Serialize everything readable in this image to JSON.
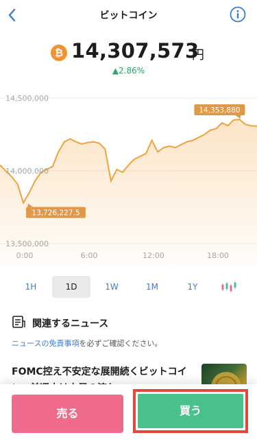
{
  "header": {
    "title": "ビットコイン",
    "back_icon": "chevron-left-icon",
    "info_icon": "info-icon"
  },
  "price": {
    "coin_symbol": "₿",
    "value": "14,307,573",
    "unit": "円",
    "change": "▲2.86%",
    "change_color": "#2ea36f"
  },
  "chart_data": {
    "type": "area",
    "color": "#f0a23b",
    "y_ticks": [
      "14,500,000",
      "14,000,000",
      "13,500,000"
    ],
    "x_ticks": [
      "0:00",
      "6:00",
      "12:00",
      "18:00"
    ],
    "ylim": [
      13500000,
      14500000
    ],
    "max_label": "14,353,880",
    "min_label": "13,726,227.5",
    "y": [
      14040000,
      14000000,
      13960000,
      13910000,
      13780000,
      13850000,
      13930000,
      13990000,
      14010000,
      14030000,
      14130000,
      14200000,
      14220000,
      14200000,
      14185000,
      14195000,
      14200000,
      14190000,
      14150000,
      13930000,
      14010000,
      13990000,
      14040000,
      14080000,
      14100000,
      14120000,
      14210000,
      14130000,
      14160000,
      14170000,
      14160000,
      14180000,
      14200000,
      14210000,
      14230000,
      14250000,
      14280000,
      14290000,
      14330000,
      14310000,
      14350000,
      14353880,
      14320000,
      14310000,
      14307573
    ]
  },
  "tabs": [
    {
      "label": "1H"
    },
    {
      "label": "1D",
      "active": true
    },
    {
      "label": "1W"
    },
    {
      "label": "1M"
    },
    {
      "label": "1Y"
    }
  ],
  "news": {
    "title": "関連するニュース",
    "disclaimer_link": "ニュースの免責事項",
    "disclaimer_rest": "を必ずご確認ください。",
    "article_title": "FOMC控え不安定な展開続くビットコイン、前週末は上昇の流れ"
  },
  "actions": {
    "sell_label": "売る",
    "buy_label": "買う"
  }
}
